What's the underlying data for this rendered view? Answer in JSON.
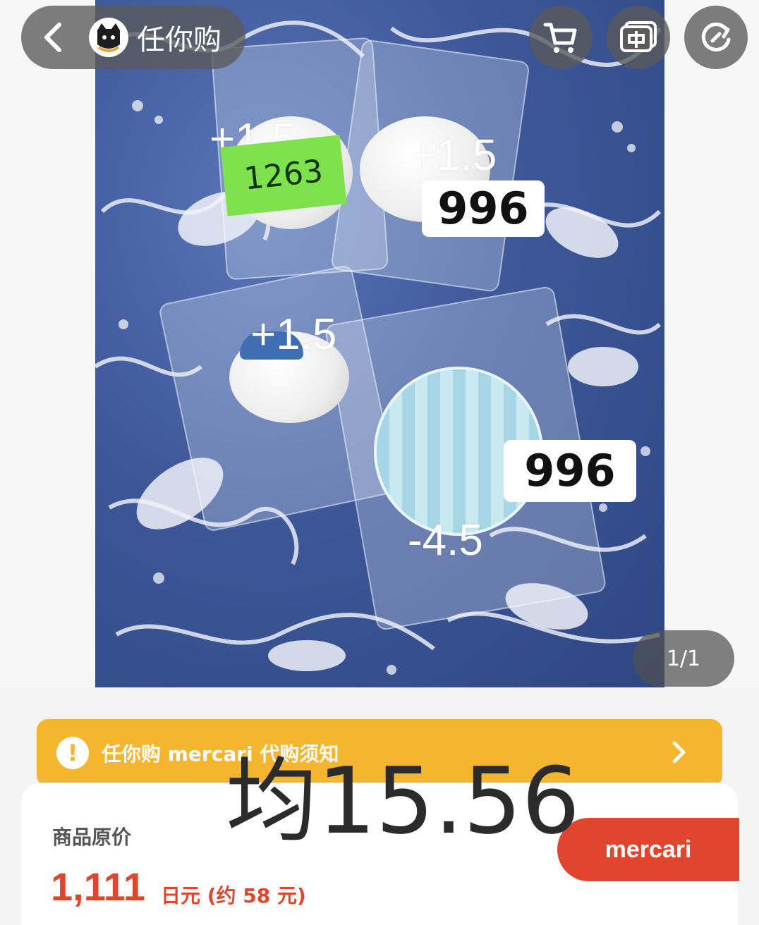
{
  "header": {
    "brand": "任你购"
  },
  "photo": {
    "overlays": [
      "+1.5",
      "+1.5",
      "+1.5",
      "-4.5"
    ],
    "tags": [
      "1263",
      "996",
      "996"
    ],
    "page_indicator": "1/1"
  },
  "notice": {
    "icon": "!",
    "text": "任你购 mercari 代购须知"
  },
  "product": {
    "original_price_label": "商品原价",
    "price": "1,111",
    "price_sub": "日元 (约 58 元)",
    "avg_overlay": "均15.56"
  },
  "actions": {
    "mercari_label": "mercari"
  },
  "colors": {
    "accent_orange": "#f6b52f",
    "price_red": "#e0452d",
    "tag_green": "#7de24c"
  }
}
